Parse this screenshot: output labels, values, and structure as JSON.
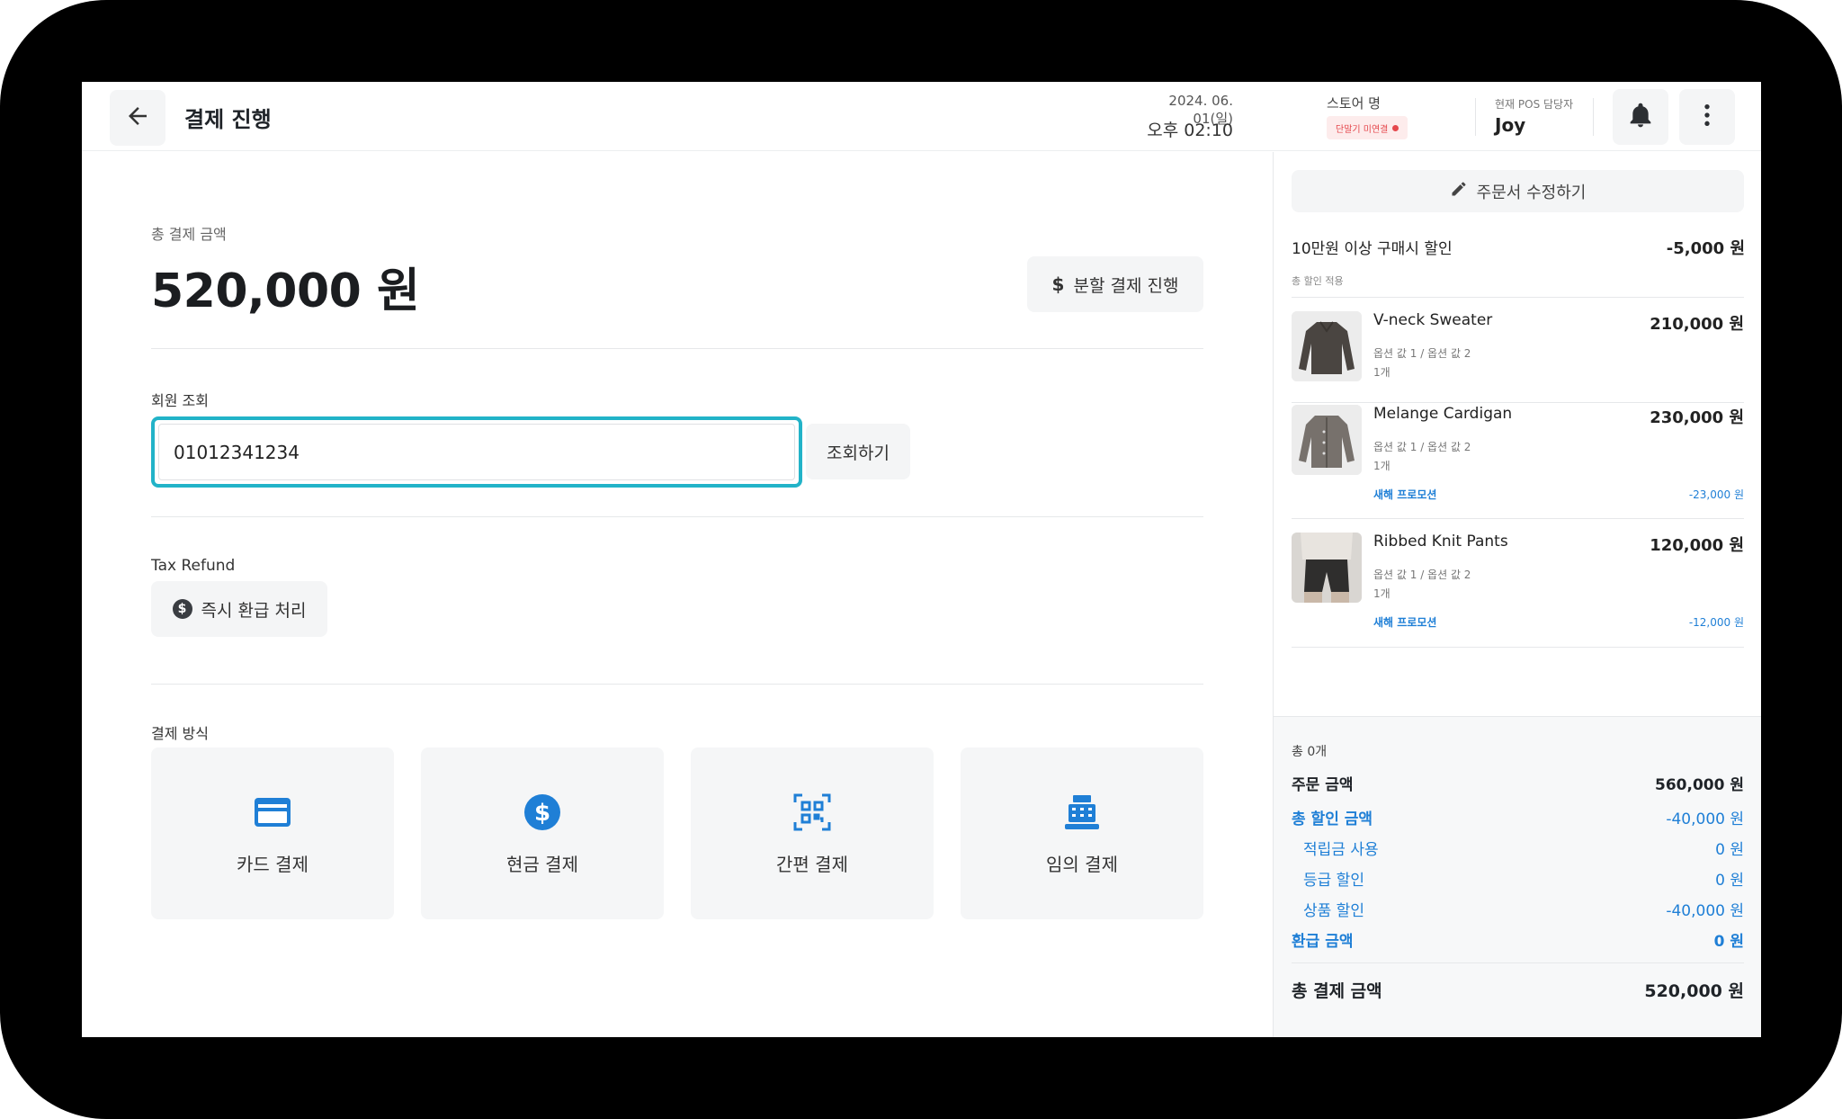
{
  "header": {
    "title": "결제 진행",
    "date": "2024. 06. 01(일)",
    "time": "오후 02:10",
    "store_name": "스토어 명",
    "terminal_status": "단말기 미연결",
    "cashier_label": "현재 POS 담당자",
    "cashier_name": "Joy"
  },
  "main": {
    "total_label": "총 결제 금액",
    "total_amount": "520,000 원",
    "split_button": "분할 결제 진행",
    "member_label": "회원 조회",
    "member_input_value": "01012341234",
    "lookup_button": "조회하기",
    "tax_label": "Tax Refund",
    "refund_button": "즉시 환급 처리",
    "payment_label": "결제 방식",
    "payment_methods": [
      {
        "label": "카드 결제",
        "icon": "card-icon"
      },
      {
        "label": "현금 결제",
        "icon": "dollar-circle-icon"
      },
      {
        "label": "간편 결제",
        "icon": "qr-icon"
      },
      {
        "label": "임의 결제",
        "icon": "cash-register-icon"
      }
    ]
  },
  "side": {
    "edit_order_button": "주문서 수정하기",
    "discount": {
      "title": "10만원 이상 구매시 할인",
      "value": "-5,000 원",
      "sub": "총 할인 적용"
    },
    "items": [
      {
        "name": "V-neck Sweater",
        "price": "210,000 원",
        "options": "옵션 값 1 / 옵션 값 2",
        "qty": "1개",
        "promo": "",
        "promo_value": ""
      },
      {
        "name": "Melange Cardigan",
        "price": "230,000 원",
        "options": "옵션 값 1 / 옵션 값 2",
        "qty": "1개",
        "promo": "새해 프로모션",
        "promo_value": "-23,000 원"
      },
      {
        "name": "Ribbed Knit Pants",
        "price": "120,000 원",
        "options": "옵션 값 1 / 옵션 값 2",
        "qty": "1개",
        "promo": "새해 프로모션",
        "promo_value": "-12,000 원"
      }
    ],
    "summary": {
      "count": "총 0개",
      "order_amount_label": "주문 금액",
      "order_amount": "560,000 원",
      "total_discount_label": "총 할인 금액",
      "total_discount": "-40,000 원",
      "points_label": "적립금 사용",
      "points": "0 원",
      "grade_label": "등급 할인",
      "grade": "0 원",
      "product_label": "상품 할인",
      "product": "-40,000 원",
      "refund_label": "환급 금액",
      "refund": "0 원",
      "total_label": "총 결제 금액",
      "total": "520,000 원"
    }
  },
  "colors": {
    "accent_blue": "#1f7fd6",
    "focus_teal": "#22b3c8",
    "alert_red": "#e5484d"
  }
}
